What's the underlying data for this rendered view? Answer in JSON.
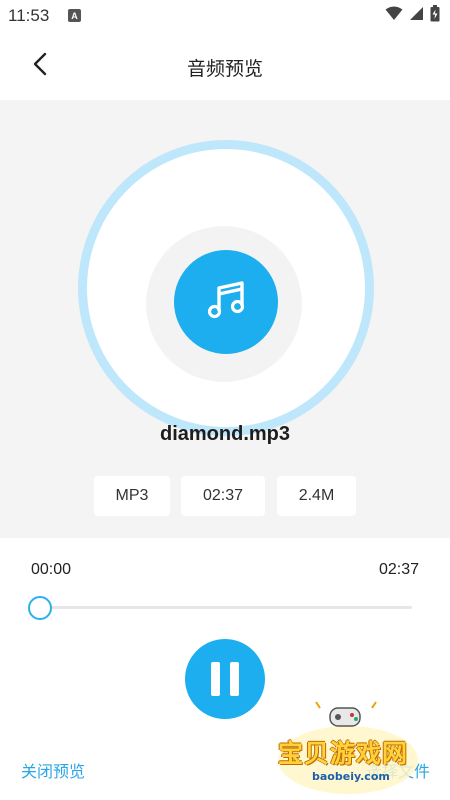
{
  "status_bar": {
    "time": "11:53",
    "notification_badge": "A"
  },
  "header": {
    "title": "音频预览",
    "back_icon": "chevron-left-icon"
  },
  "audio": {
    "file_name": "diamond.mp3",
    "format": "MP3",
    "duration": "02:37",
    "size": "2.4M",
    "music_icon": "music-note-icon"
  },
  "player": {
    "current_time": "00:00",
    "total_time": "02:37",
    "progress": 0,
    "state_icon": "pause-icon"
  },
  "actions": {
    "close_label": "关闭预览",
    "select_label": "选择文件"
  },
  "watermark": {
    "text": "宝贝游戏网",
    "url": "baobeiy.com"
  },
  "colors": {
    "accent": "#1caeef",
    "ring": "#bfe7fb",
    "panel_bg": "#f4f4f4",
    "link": "#2aa6e6"
  }
}
